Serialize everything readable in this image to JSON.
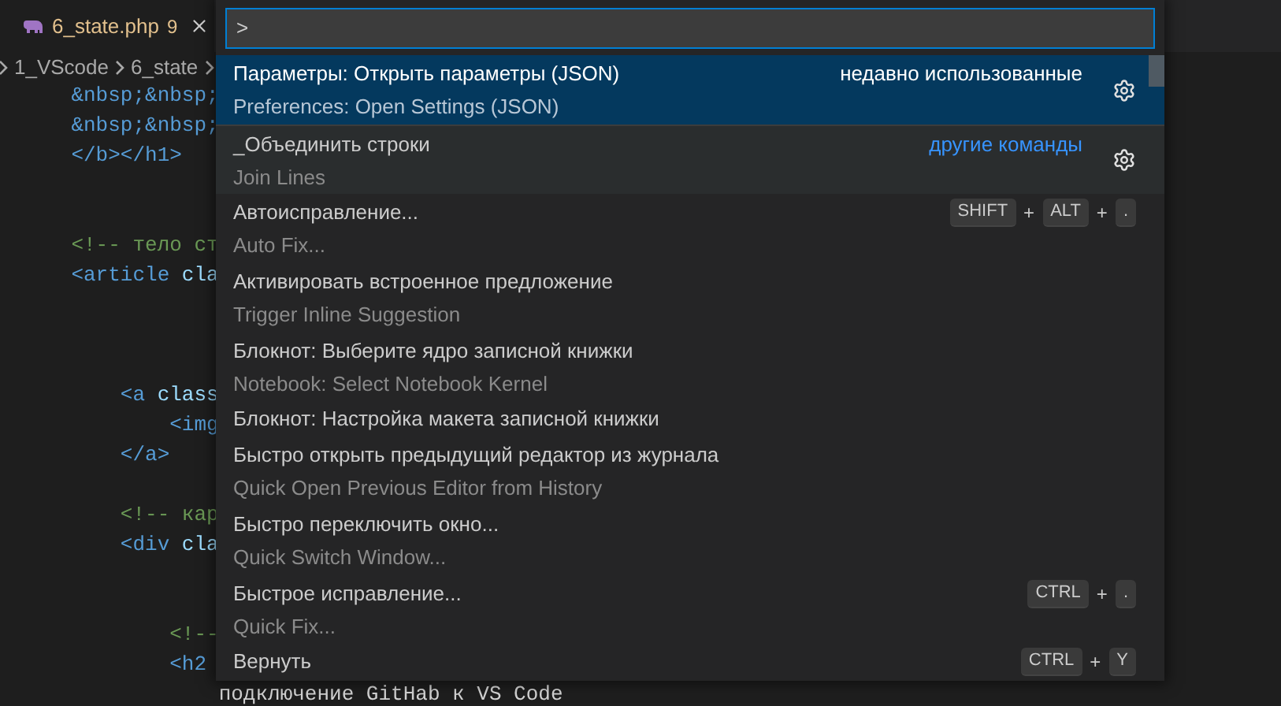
{
  "tab": {
    "filename": "6_state.php",
    "problems": "9",
    "selected": true
  },
  "breadcrumb": [
    "1_VScode",
    "6_state"
  ],
  "code_lines": [
    {
      "kind": "code",
      "tokens": [
        {
          "text": "    &nbsp;&nbsp;",
          "kind": "entity"
        }
      ]
    },
    {
      "kind": "code",
      "tokens": [
        {
          "text": "    &nbsp;&nbsp;",
          "kind": "entity"
        }
      ]
    },
    {
      "kind": "code",
      "tokens": [
        {
          "text": "    </b></h1>",
          "kind": "tag"
        }
      ]
    },
    {
      "kind": "blank"
    },
    {
      "kind": "blank"
    },
    {
      "kind": "code",
      "tokens": [
        {
          "text": "    <!-- тело ст",
          "kind": "comment"
        }
      ]
    },
    {
      "kind": "code",
      "tokens": [
        {
          "text": "    <article",
          "kind": "tag"
        },
        {
          "text": " cla",
          "kind": "attr"
        }
      ]
    },
    {
      "kind": "blank"
    },
    {
      "kind": "blank"
    },
    {
      "kind": "blank"
    },
    {
      "kind": "code",
      "tokens": [
        {
          "text": "        <a",
          "kind": "tag"
        },
        {
          "text": " class",
          "kind": "attr"
        }
      ]
    },
    {
      "kind": "code",
      "tokens": [
        {
          "text": "            <img",
          "kind": "tag"
        }
      ]
    },
    {
      "kind": "code",
      "tokens": [
        {
          "text": "        </a>",
          "kind": "tag"
        }
      ]
    },
    {
      "kind": "blank"
    },
    {
      "kind": "code",
      "tokens": [
        {
          "text": "        <!-- кар",
          "kind": "comment"
        }
      ]
    },
    {
      "kind": "code",
      "tokens": [
        {
          "text": "        <div",
          "kind": "tag"
        },
        {
          "text": " cla",
          "kind": "attr"
        }
      ]
    },
    {
      "kind": "blank"
    },
    {
      "kind": "blank"
    },
    {
      "kind": "code",
      "tokens": [
        {
          "text": "            <!--",
          "kind": "comment"
        }
      ]
    },
    {
      "kind": "code",
      "tokens": [
        {
          "text": "            <h2",
          "kind": "tag"
        }
      ]
    },
    {
      "kind": "code",
      "tokens": [
        {
          "text": "                подключение GitHab к VS Code",
          "kind": "text"
        }
      ]
    }
  ],
  "palette": {
    "input_value": ">",
    "items": [
      {
        "label": "Параметры: Открыть параметры (JSON)",
        "detail": "Preferences: Open Settings (JSON)",
        "group_label": "недавно использованные",
        "selected": true,
        "hovered": false
      },
      {
        "label": "_Объединить строки",
        "detail": "Join Lines",
        "group_label": "другие команды",
        "selected": false,
        "hovered": true
      },
      {
        "label": "Автоисправление...",
        "detail": "Auto Fix...",
        "keybinding": [
          {
            "text": "SHIFT",
            "kind": "key"
          },
          {
            "text": "+",
            "kind": "plus"
          },
          {
            "text": "ALT",
            "kind": "key"
          },
          {
            "text": "+",
            "kind": "plus"
          },
          {
            "text": ".",
            "kind": "key"
          }
        ],
        "selected": false,
        "hovered": false
      },
      {
        "label": "Активировать встроенное предложение",
        "detail": "Trigger Inline Suggestion",
        "selected": false,
        "hovered": false
      },
      {
        "label": "Блокнот: Выберите ядро записной книжки",
        "detail": "Notebook: Select Notebook Kernel",
        "selected": false,
        "hovered": false
      },
      {
        "label": "Блокнот: Настройка макета записной книжки",
        "selected": false,
        "hovered": false
      },
      {
        "label": "Быстро открыть предыдущий редактор из журнала",
        "detail": "Quick Open Previous Editor from History",
        "selected": false,
        "hovered": false
      },
      {
        "label": "Быстро переключить окно...",
        "detail": "Quick Switch Window...",
        "selected": false,
        "hovered": false
      },
      {
        "label": "Быстрое исправление...",
        "detail": "Quick Fix...",
        "keybinding": [
          {
            "text": "CTRL",
            "kind": "key"
          },
          {
            "text": "+",
            "kind": "plus"
          },
          {
            "text": ".",
            "kind": "key"
          }
        ],
        "selected": false,
        "hovered": false
      },
      {
        "label": "Вернуть",
        "keybinding": [
          {
            "text": "CTRL",
            "kind": "key"
          },
          {
            "text": "+",
            "kind": "plus"
          },
          {
            "text": "Y",
            "kind": "key"
          }
        ],
        "selected": false,
        "hovered": false
      }
    ]
  }
}
